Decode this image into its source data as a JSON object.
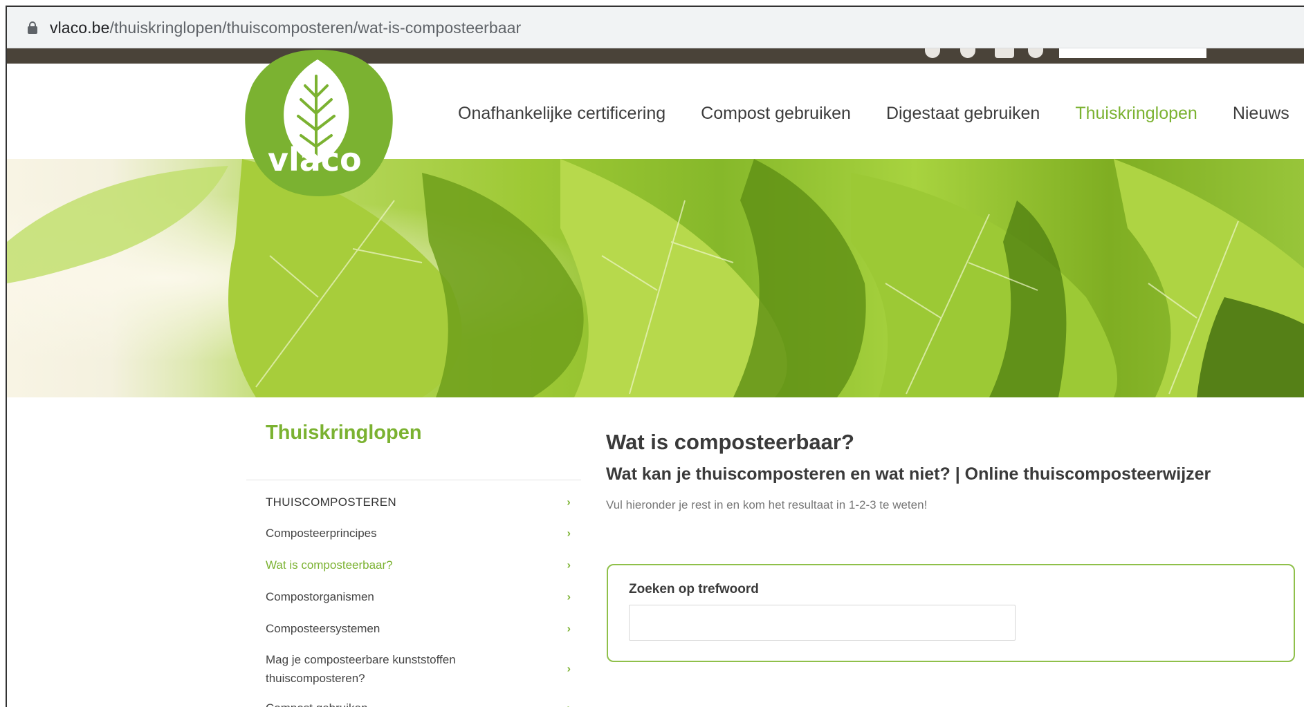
{
  "browser": {
    "url_host": "vlaco.be",
    "url_path": "/thuiskringlopen/thuiscomposteren/wat-is-composteerbaar"
  },
  "logo": {
    "text": "vlaco",
    "colors": {
      "green": "#7bb231",
      "white": "#ffffff"
    }
  },
  "nav": {
    "items": [
      {
        "label": "Onafhankelijke certificering"
      },
      {
        "label": "Compost gebruiken"
      },
      {
        "label": "Digestaat gebruiken"
      },
      {
        "label": "Thuiskringlopen",
        "active": true
      },
      {
        "label": "Nieuws"
      }
    ]
  },
  "sidebar": {
    "title": "Thuiskringlopen",
    "items": [
      {
        "label": "THUISCOMPOSTEREN"
      },
      {
        "label": "Composteerprincipes"
      },
      {
        "label": "Wat is composteerbaar?",
        "active": true
      },
      {
        "label": "Compostorganismen"
      },
      {
        "label": "Composteersystemen"
      },
      {
        "label": "Mag je composteerbare kunststoffen thuiscomposteren?"
      },
      {
        "label": "Compost gebruiken"
      }
    ]
  },
  "main": {
    "title": "Wat is composteerbaar?",
    "subtitle": "Wat kan je thuiscomposteren en wat niet? | Online thuiscomposteerwijzer",
    "intro": "Vul hieronder je rest in en kom het resultaat in 1-2-3 te weten!",
    "search": {
      "label": "Zoeken op trefwoord",
      "value": "",
      "placeholder": ""
    }
  },
  "colors": {
    "accent": "#7bb231",
    "topbar": "#4a4339",
    "text": "#3a3a3a"
  }
}
